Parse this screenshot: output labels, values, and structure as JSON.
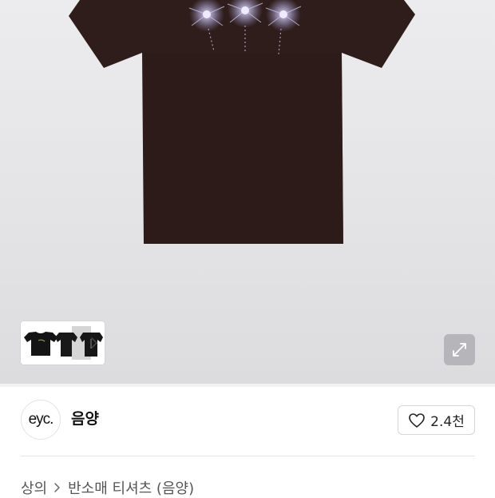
{
  "product": {
    "image_alt": "brown short-sleeve t-shirt with three firework prints"
  },
  "gallery": {
    "thumbnail_count": 3
  },
  "brand": {
    "logo_text": "eyc.",
    "name": "음양"
  },
  "like": {
    "count": "2.4천"
  },
  "breadcrumb": {
    "category": "상의",
    "subcategory": "반소매 티셔츠 (음양)"
  },
  "colors": {
    "shirt": "#2e1d1a",
    "hero_background": "#e6e6e8",
    "firework": "#c9c4e6"
  }
}
